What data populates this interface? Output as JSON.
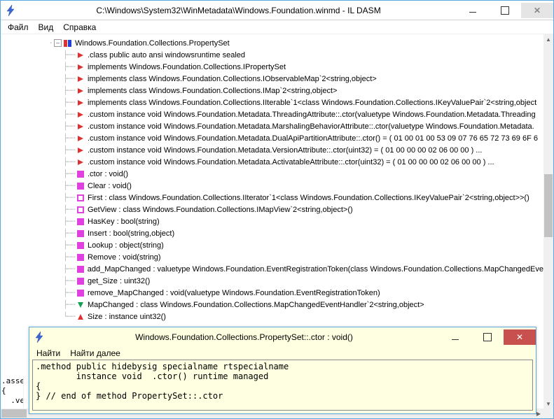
{
  "main_window": {
    "title": "C:\\Windows\\System32\\WinMetadata\\Windows.Foundation.winmd - IL DASM",
    "menubar": [
      "Файл",
      "Вид",
      "Справка"
    ]
  },
  "tree": {
    "root_label": "Windows.Foundation.Collections.PropertySet",
    "items": [
      {
        "icon": "red-tri",
        "label": ".class public auto ansi windowsruntime sealed"
      },
      {
        "icon": "red-tri",
        "label": "implements Windows.Foundation.Collections.IPropertySet"
      },
      {
        "icon": "red-tri",
        "label": "implements class Windows.Foundation.Collections.IObservableMap`2<string,object>"
      },
      {
        "icon": "red-tri",
        "label": "implements class Windows.Foundation.Collections.IMap`2<string,object>"
      },
      {
        "icon": "red-tri",
        "label": "implements class Windows.Foundation.Collections.IIterable`1<class Windows.Foundation.Collections.IKeyValuePair`2<string,object"
      },
      {
        "icon": "red-tri",
        "label": ".custom instance void Windows.Foundation.Metadata.ThreadingAttribute::.ctor(valuetype Windows.Foundation.Metadata.Threading"
      },
      {
        "icon": "red-tri",
        "label": ".custom instance void Windows.Foundation.Metadata.MarshalingBehaviorAttribute::.ctor(valuetype Windows.Foundation.Metadata."
      },
      {
        "icon": "red-tri",
        "label": ".custom instance void Windows.Foundation.Metadata.DualApiPartitionAttribute::.ctor() = ( 01 00 01 00 53 09 07 76 65 72 73 69 6F 6"
      },
      {
        "icon": "red-tri",
        "label": ".custom instance void Windows.Foundation.Metadata.VersionAttribute::.ctor(uint32) = ( 01 00 00 00 02 06 00 00 )  ..."
      },
      {
        "icon": "red-tri",
        "label": ".custom instance void Windows.Foundation.Metadata.ActivatableAttribute::.ctor(uint32) = ( 01 00 00 00 02 06 00 00 )  ..."
      },
      {
        "icon": "pink",
        "label": ".ctor : void()"
      },
      {
        "icon": "pink",
        "label": "Clear : void()"
      },
      {
        "icon": "pink-out",
        "label": "First : class Windows.Foundation.Collections.IIterator`1<class Windows.Foundation.Collections.IKeyValuePair`2<string,object>>()"
      },
      {
        "icon": "pink-out",
        "label": "GetView : class Windows.Foundation.Collections.IMapView`2<string,object>()"
      },
      {
        "icon": "pink",
        "label": "HasKey : bool(string)"
      },
      {
        "icon": "pink",
        "label": "Insert : bool(string,object)"
      },
      {
        "icon": "pink",
        "label": "Lookup : object(string)"
      },
      {
        "icon": "pink",
        "label": "Remove : void(string)"
      },
      {
        "icon": "pink",
        "label": "add_MapChanged : valuetype Windows.Foundation.EventRegistrationToken(class Windows.Foundation.Collections.MapChangedEve"
      },
      {
        "icon": "pink",
        "label": "get_Size : uint32()"
      },
      {
        "icon": "pink",
        "label": "remove_MapChanged : void(valuetype Windows.Foundation.EventRegistrationToken)"
      },
      {
        "icon": "green-tri",
        "label": "MapChanged : class Windows.Foundation.Collections.MapChangedEventHandler`2<string,object>"
      },
      {
        "icon": "red-up",
        "label": "Size : instance uint32()"
      }
    ]
  },
  "assembly_snippet": ".assen\n{\n  .ver :",
  "il_window": {
    "title": "Windows.Foundation.Collections.PropertySet::.ctor : void()",
    "menubar": [
      "Найти",
      "Найти далее"
    ],
    "body": ".method public hidebysig specialname rtspecialname \n        instance void  .ctor() runtime managed\n{\n} // end of method PropertySet::.ctor"
  }
}
